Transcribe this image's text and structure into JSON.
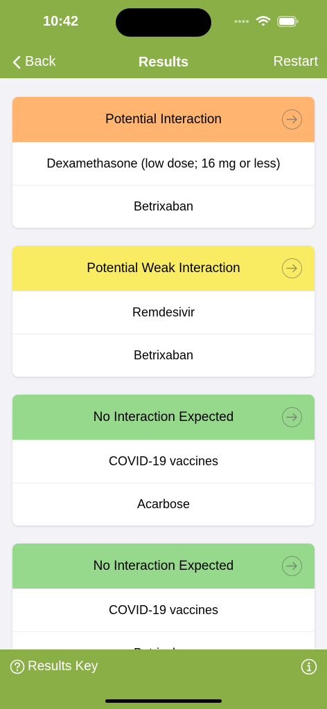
{
  "status_bar": {
    "time": "10:42"
  },
  "nav": {
    "back_label": "Back",
    "title": "Results",
    "restart_label": "Restart"
  },
  "cards": [
    {
      "header": "Potential Interaction",
      "color": "#ffb570",
      "rows": [
        "Dexamethasone (low dose; 16 mg or less)",
        "Betrixaban"
      ]
    },
    {
      "header": "Potential Weak Interaction",
      "color": "#f9ec62",
      "rows": [
        "Remdesivir",
        "Betrixaban"
      ]
    },
    {
      "header": "No Interaction Expected",
      "color": "#96d98c",
      "rows": [
        "COVID-19 vaccines",
        "Acarbose"
      ]
    },
    {
      "header": "No Interaction Expected",
      "color": "#96d98c",
      "rows": [
        "COVID-19 vaccines",
        "Betrixaban"
      ]
    }
  ],
  "bottom_bar": {
    "results_key_label": "Results Key"
  },
  "colors": {
    "bar_green": "#8aaf46",
    "orange": "#ffb570",
    "yellow": "#f9ec62",
    "green": "#96d98c"
  },
  "icons": [
    "chevron-left-icon",
    "arrow-right-circle-icon",
    "question-circle-icon",
    "info-circle-icon",
    "wifi-icon",
    "battery-icon",
    "signal-icon"
  ]
}
